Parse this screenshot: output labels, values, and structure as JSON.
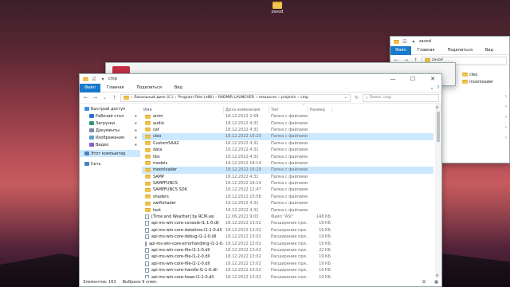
{
  "desktop": {
    "icon_label": "zavod"
  },
  "win_back": {
    "title": "zavod",
    "ribbon": [
      "Файл",
      "Главная",
      "Поделиться",
      "Вид"
    ],
    "address": "zavod",
    "items": [
      "cleo",
      "moonloader"
    ]
  },
  "win_mid": {
    "title": ""
  },
  "win_main": {
    "title": "cmp",
    "ribbon": [
      "Файл",
      "Главная",
      "Поделиться",
      "Вид"
    ],
    "address": [
      "Локальный диск (C:)",
      "Program Files (x86)",
      "RADMIR LAUNCHER",
      "resources",
      "projects",
      "cmp"
    ],
    "search_placeholder": "Поиск: cmp",
    "sidebar": [
      {
        "label": "Быстрый доступ",
        "pin": false,
        "sel": false
      },
      {
        "label": "Рабочий стол",
        "pin": true,
        "sel": false
      },
      {
        "label": "Загрузки",
        "pin": true,
        "sel": false
      },
      {
        "label": "Документы",
        "pin": true,
        "sel": false
      },
      {
        "label": "Изображения",
        "pin": true,
        "sel": false
      },
      {
        "label": "Видео",
        "pin": true,
        "sel": false
      },
      {
        "label": "Этот компьютер",
        "pin": false,
        "sel": true
      },
      {
        "label": "Сеть",
        "pin": false,
        "sel": false
      }
    ],
    "columns": {
      "name": "Имя",
      "date": "Дата изменения",
      "type": "Тип",
      "size": "Размер"
    },
    "rows": [
      {
        "name": "anim",
        "date": "18.12.2022 2:58",
        "type": "Папка с файлами",
        "size": "",
        "kind": "folder",
        "sel": false
      },
      {
        "name": "audio",
        "date": "18.12.2022 4:31",
        "type": "Папка с файлами",
        "size": "",
        "kind": "folder",
        "sel": false
      },
      {
        "name": "caf",
        "date": "18.12.2022 4:31",
        "type": "Папка с файлами",
        "size": "",
        "kind": "folder",
        "sel": false
      },
      {
        "name": "cleo",
        "date": "18.12.2022 16:29",
        "type": "Папка с файлами",
        "size": "",
        "kind": "folder",
        "sel": true
      },
      {
        "name": "CustomSAA2",
        "date": "18.12.2022 4:31",
        "type": "Папка с файлами",
        "size": "",
        "kind": "folder",
        "sel": false
      },
      {
        "name": "data",
        "date": "18.12.2022 4:31",
        "type": "Папка с файлами",
        "size": "",
        "kind": "folder",
        "sel": false
      },
      {
        "name": "libs",
        "date": "18.12.2022 4:31",
        "type": "Папка с файлами",
        "size": "",
        "kind": "folder",
        "sel": false
      },
      {
        "name": "models",
        "date": "18.12.2022 18:14",
        "type": "Папка с файлами",
        "size": "",
        "kind": "folder",
        "sel": false
      },
      {
        "name": "moonloader",
        "date": "18.12.2022 16:29",
        "type": "Папка с файлами",
        "size": "",
        "kind": "folder",
        "sel": true
      },
      {
        "name": "SAMP",
        "date": "18.12.2022 4:31",
        "type": "Папка с файлами",
        "size": "",
        "kind": "folder",
        "sel": false
      },
      {
        "name": "SAMPFUNCS",
        "date": "18.12.2022 18:14",
        "type": "Папка с файлами",
        "size": "",
        "kind": "folder",
        "sel": false
      },
      {
        "name": "SAMPFUNCS SDK",
        "date": "18.12.2022 12:47",
        "type": "Папка с файлами",
        "size": "",
        "kind": "folder",
        "sel": false
      },
      {
        "name": "shaders",
        "date": "18.12.2022 15:58",
        "type": "Папка с файлами",
        "size": "",
        "kind": "folder",
        "sel": false
      },
      {
        "name": "swiftshader",
        "date": "18.12.2022 4:31",
        "type": "Папка с файлами",
        "size": "",
        "kind": "folder",
        "sel": false
      },
      {
        "name": "text",
        "date": "18.12.2022 4:31",
        "type": "Папка с файлами",
        "size": "",
        "kind": "folder",
        "sel": false
      },
      {
        "name": "[Time and Weather] by RCM.asi",
        "date": "12.06.2021 9:03",
        "type": "Файл \"ASI\"",
        "size": "148 КБ",
        "kind": "file",
        "sel": false
      },
      {
        "name": "api-ms-win-core-console-l1-1-0.dll",
        "date": "18.12.2022 13:02",
        "type": "Расширение при...",
        "size": "19 КБ",
        "kind": "file",
        "sel": false
      },
      {
        "name": "api-ms-win-core-datetime-l1-1-0.dll",
        "date": "18.12.2022 13:02",
        "type": "Расширение при...",
        "size": "19 КБ",
        "kind": "file",
        "sel": false
      },
      {
        "name": "api-ms-win-core-debug-l1-1-0.dll",
        "date": "18.12.2022 13:02",
        "type": "Расширение при...",
        "size": "19 КБ",
        "kind": "file",
        "sel": false
      },
      {
        "name": "api-ms-win-core-errorhandling-l1-1-0.dll",
        "date": "18.12.2022 13:02",
        "type": "Расширение при...",
        "size": "19 КБ",
        "kind": "file",
        "sel": false
      },
      {
        "name": "api-ms-win-core-file-l1-1-0.dll",
        "date": "18.12.2022 13:02",
        "type": "Расширение при...",
        "size": "22 КБ",
        "kind": "file",
        "sel": false
      },
      {
        "name": "api-ms-win-core-file-l1-2-0.dll",
        "date": "18.12.2022 13:02",
        "type": "Расширение при...",
        "size": "19 КБ",
        "kind": "file",
        "sel": false
      },
      {
        "name": "api-ms-win-core-file-l2-1-0.dll",
        "date": "18.12.2022 13:02",
        "type": "Расширение при...",
        "size": "19 КБ",
        "kind": "file",
        "sel": false
      },
      {
        "name": "api-ms-win-core-handle-l1-1-0.dll",
        "date": "18.12.2022 13:02",
        "type": "Расширение при...",
        "size": "19 КБ",
        "kind": "file",
        "sel": false
      },
      {
        "name": "api-ms-win-core-heap-l1-1-0.dll",
        "date": "18.12.2022 13:02",
        "type": "Расширение при...",
        "size": "19 КБ",
        "kind": "file",
        "sel": false
      }
    ],
    "status": {
      "count": "Элементов: 163",
      "selected": "Выбрано 9 элем."
    }
  }
}
